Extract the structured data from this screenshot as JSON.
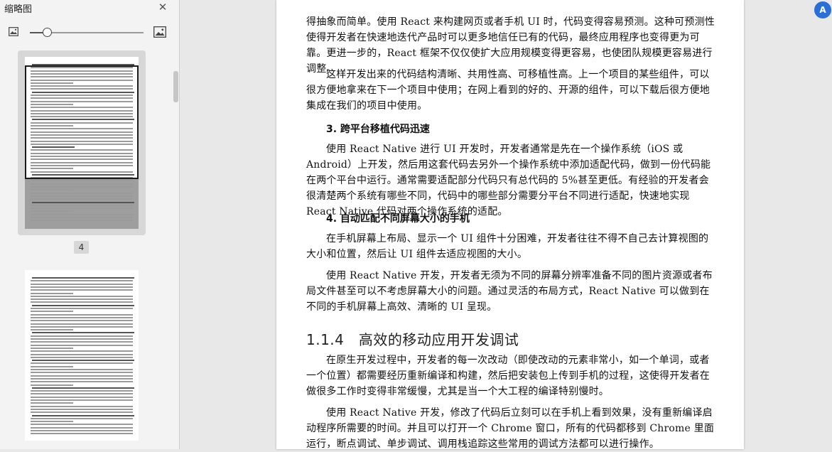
{
  "sidebar": {
    "title": "缩略图",
    "current_page_label": "4",
    "zoom_level": 0.15
  },
  "page": {
    "para1": "得抽象而简单。使用 React 来构建网页或者手机 UI 时，代码变得容易预测。这种可预测性使得开发者在快速地迭代产品时可以更多地信任已有的代码，最终应用程序也变得更为可靠。更进一步的，React 框架不仅仅使扩大应用规模变得更容易，也使团队规模更容易进行调整。",
    "para2": "这样开发出来的代码结构清晰、共用性高、可移植性高。上一个项目的某些组件，可以很方便地拿来在下一个项目中使用；在网上看到的好的、开源的组件，可以下载后很方便地集成在我们的项目中使用。",
    "sub3": "3. 跨平台移植代码迅速",
    "para3": "使用 React Native 进行 UI 开发时，开发者通常是先在一个操作系统（iOS 或 Android）上开发，然后用这套代码去另外一个操作系统中添加适配代码，做到一份代码能在两个平台中运行。通常需要适配部分代码只有总代码的 5%甚至更低。有经验的开发者会很清楚两个系统有哪些不同，代码中的哪些部分需要分平台不同进行适配，快速地实现 React Native 代码对两个操作系统的适配。",
    "sub4": "4. 自动匹配不同屏幕大小的手机",
    "para4": "在手机屏幕上布局、显示一个 UI 组件十分困难，开发者往往不得不自己去计算视图的大小和位置，然后让 UI 组件去适应视图的大小。",
    "para5": "使用 React Native 开发，开发者无须为不同的屏幕分辨率准备不同的图片资源或者布局文件甚至可以不考虑屏幕大小的问题。通过灵活的布局方式，React Native 可以做到在不同的手机屏幕上高效、清晰的 UI 呈现。",
    "section": "1.1.4　高效的移动应用开发调试",
    "para6": "在原生开发过程中，开发者的每一次改动（即使改动的元素非常小，如一个单词，或者一个位置）都需要经历重新编译和构建，然后把安装包上传到手机的过程，这使得开发者在做很多工作时变得非常缓慢，尤其是当一个大工程的编译特别慢时。",
    "para7": "使用 React Native 开发，修改了代码后立刻可以在手机上看到效果，没有重新编译启动程序所需要的时间。并且可以打开一个 Chrome 窗口，所有的代码都移到 Chrome 里面运行，断点调试、单步调试、调用栈追踪这些常用的调试方法都可以进行操作。"
  },
  "corner_icon_glyph": "A",
  "colors": {
    "accent": "#2a6fd8",
    "sidebar_bg": "#f3f3f3",
    "workspace_bg": "#e8e8e8"
  }
}
